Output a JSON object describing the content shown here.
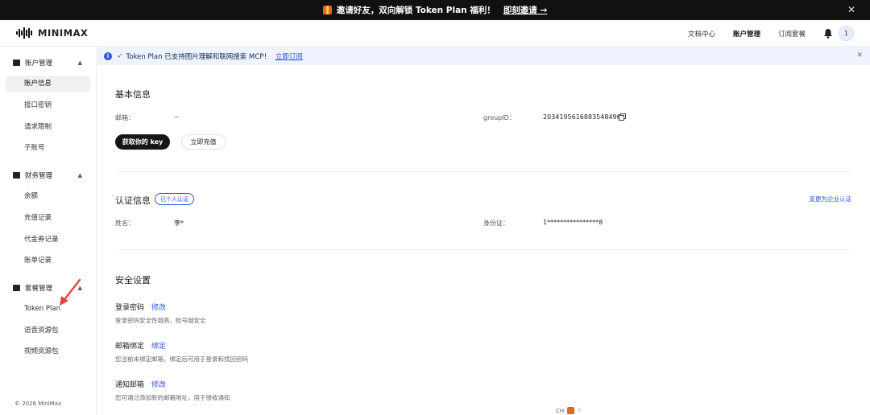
{
  "promo": {
    "text": "邀请好友，双向解锁 Token Plan 福利！",
    "cta": "即刻邀请 →",
    "close": "✕"
  },
  "header": {
    "logo_text": "MINIMAX",
    "nav": [
      "文档中心",
      "账户管理",
      "订阅套餐"
    ],
    "avatar": "1"
  },
  "sidebar": {
    "groups": [
      {
        "label": "账户管理",
        "items": [
          "账户信息",
          "接口密钥",
          "请求限制",
          "子账号"
        ]
      },
      {
        "label": "财务管理",
        "items": [
          "余额",
          "充值记录",
          "代金券记录",
          "账单记录"
        ]
      },
      {
        "label": "套餐管理",
        "items": [
          "Token Plan",
          "语音资源包",
          "视频资源包"
        ]
      }
    ],
    "copyright": "© 2026 MiniMax"
  },
  "notice": {
    "text": "Token Plan 已支持图片理解和联网搜索 MCP！",
    "link": "立即订阅",
    "close": "✕"
  },
  "basic": {
    "title": "基本信息",
    "email_label": "邮箱：",
    "email_value": "--",
    "group_label": "groupID：",
    "group_value": "2034195616883548496",
    "get_key": "获取你的 key",
    "recharge": "立即充值"
  },
  "auth": {
    "title": "认证信息",
    "badge": "已个人认证",
    "change_link": "变更为企业认证",
    "name_label": "姓名：",
    "name_value": "李*",
    "id_label": "身份证：",
    "id_value": "1****************8"
  },
  "security": {
    "title": "安全设置",
    "rows": [
      {
        "title": "登录密码",
        "action": "修改",
        "desc": "登录密码安全性越高，账号越安全"
      },
      {
        "title": "邮箱绑定",
        "action": "绑定",
        "desc": "您当前未绑定邮箱，绑定后可用于登录和找回密码"
      },
      {
        "title": "通知邮箱",
        "action": "修改",
        "desc": "您可通过添加新的邮箱地址，用于接收通知"
      }
    ]
  },
  "floating": {
    "label": "CH",
    "dots": "⠿"
  },
  "colors": {
    "accent": "#2c57d6",
    "dark": "#161616",
    "notice_bg": "#eef3fd",
    "arrow": "#e5473b"
  }
}
